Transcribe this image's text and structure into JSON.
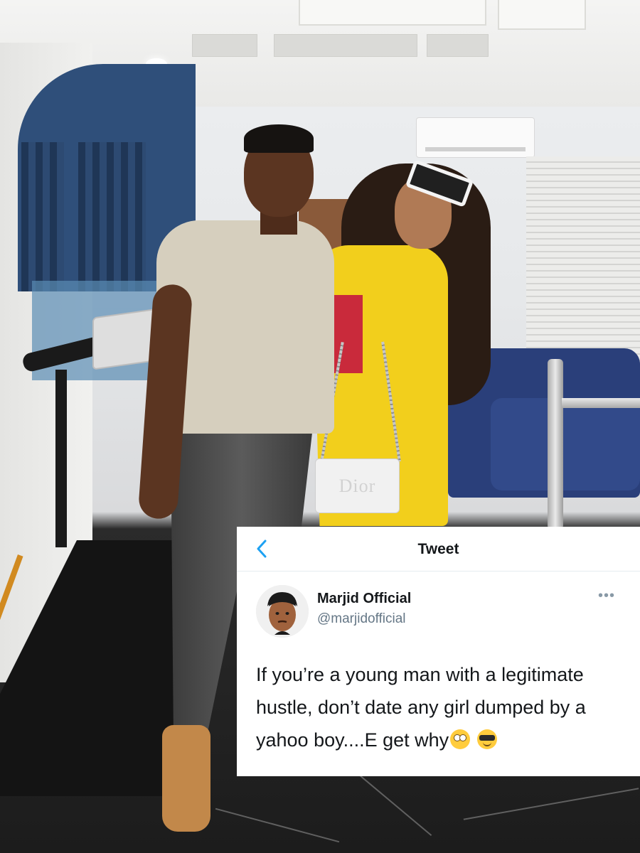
{
  "header": {
    "title": "Tweet"
  },
  "tweet": {
    "display_name": "Marjid Official",
    "handle": "@marjidofficial",
    "more_label": "•••",
    "text": "If you’re a young man with a legitimate hustle, don’t date any girl dumped by a yahoo boy....E get why",
    "emojis": [
      "face-with-rolling-eyes-icon",
      "smiling-face-with-sunglasses-icon"
    ]
  },
  "photo": {
    "bag_logo": "Dior"
  },
  "colors": {
    "accent": "#1da1f2",
    "text_primary": "#14171a",
    "text_secondary": "#657786"
  }
}
